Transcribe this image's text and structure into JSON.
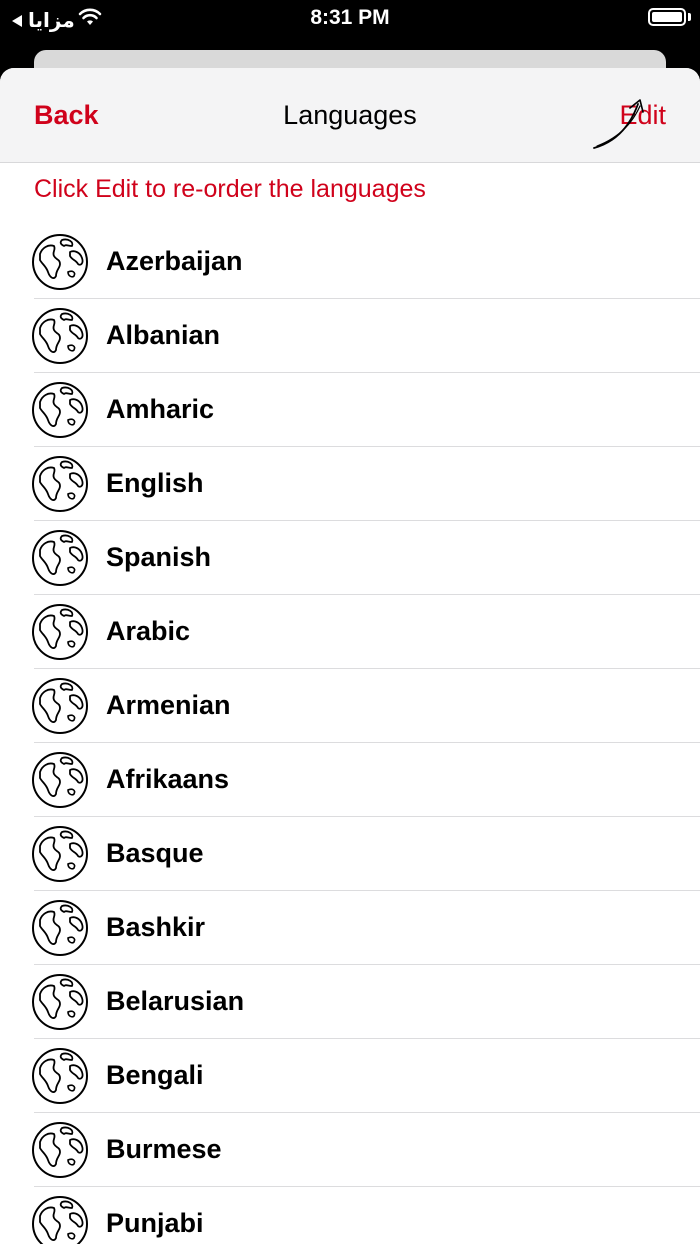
{
  "status_bar": {
    "back_app": "مزايا",
    "time": "8:31 PM"
  },
  "nav": {
    "back_label": "Back",
    "title": "Languages",
    "edit_label": "Edit"
  },
  "hint": "Click Edit to re-order the languages",
  "languages": [
    "Azerbaijan",
    "Albanian",
    "Amharic",
    "English",
    "Spanish",
    "Arabic",
    "Armenian",
    "Afrikaans",
    "Basque",
    "Bashkir",
    "Belarusian",
    "Bengali",
    "Burmese",
    "Punjabi"
  ],
  "colors": {
    "accent": "#d0021b",
    "nav_background": "#f4f4f5"
  },
  "icons": {
    "row_icon": "globe-icon",
    "hint_icon": "curved-arrow-icon"
  }
}
